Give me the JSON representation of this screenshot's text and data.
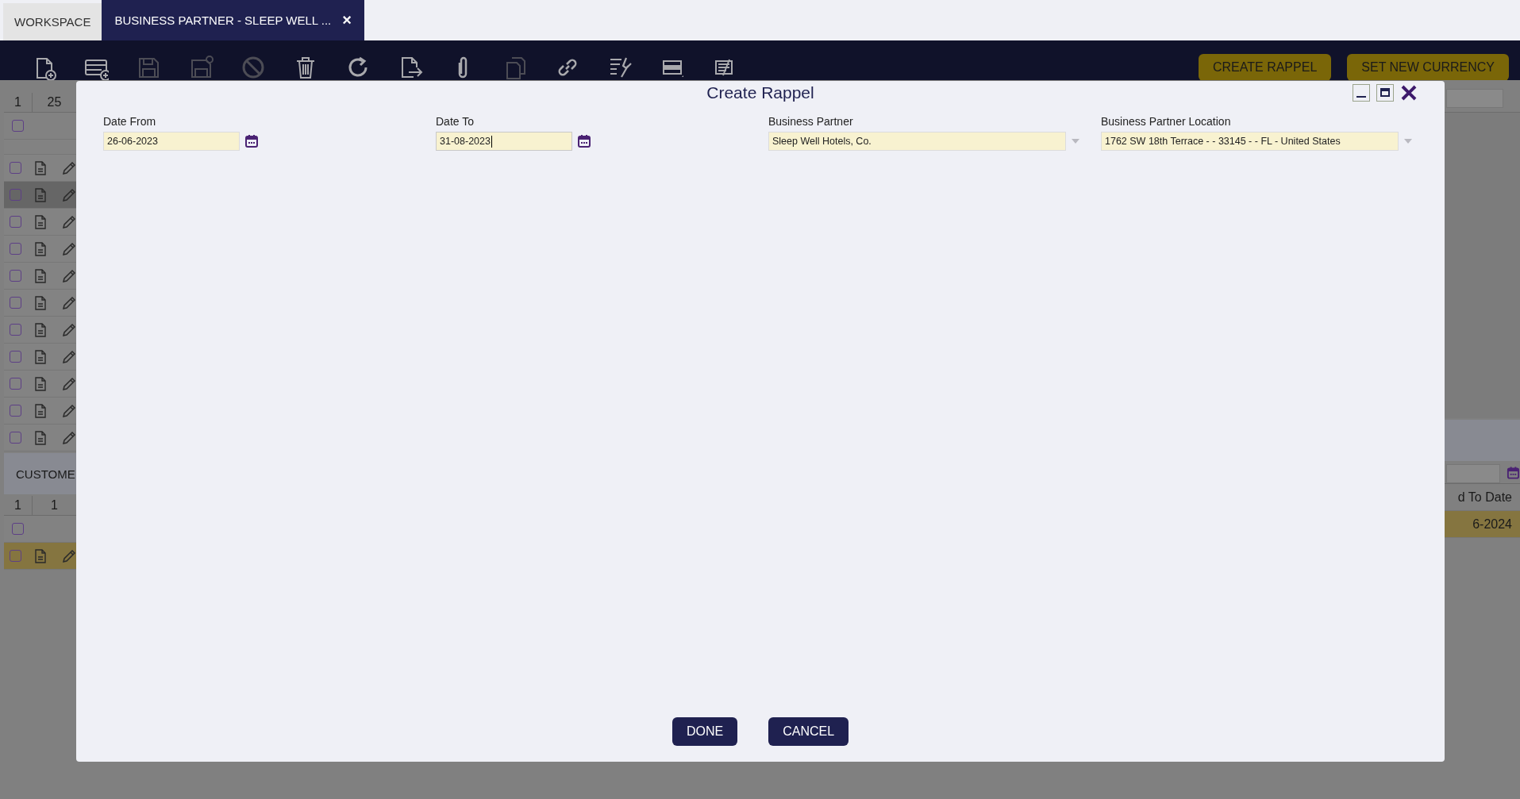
{
  "tabs": [
    {
      "label": "WORKSPACE",
      "selected": false,
      "closable": false
    },
    {
      "label": "BUSINESS PARTNER - SLEEP WELL ...",
      "selected": true,
      "closable": true,
      "close_glyph": "×"
    }
  ],
  "toolbar": [
    {
      "kind": "new-document",
      "disabled": false
    },
    {
      "kind": "new-row",
      "disabled": false
    },
    {
      "kind": "save",
      "disabled": true
    },
    {
      "kind": "save-close",
      "disabled": true
    },
    {
      "kind": "cancel",
      "disabled": true
    },
    {
      "kind": "delete",
      "disabled": false
    },
    {
      "kind": "refresh",
      "disabled": false
    },
    {
      "kind": "export",
      "disabled": false
    },
    {
      "kind": "attach",
      "disabled": false
    },
    {
      "kind": "clone",
      "disabled": true
    },
    {
      "kind": "link",
      "disabled": false
    },
    {
      "kind": "tools",
      "disabled": false
    },
    {
      "kind": "grid-view",
      "disabled": false
    },
    {
      "kind": "notes",
      "disabled": false
    }
  ],
  "actions": [
    "CREATE RAPPEL",
    "SET NEW CURRENCY"
  ],
  "grid": {
    "page": "1",
    "count": "25",
    "header_checked": false,
    "rows": [
      {
        "selected": false,
        "checked": false
      },
      {
        "selected": true,
        "checked": false
      },
      {
        "selected": false,
        "checked": false
      },
      {
        "selected": false,
        "checked": false
      },
      {
        "selected": false,
        "checked": false
      },
      {
        "selected": false,
        "checked": false
      },
      {
        "selected": false,
        "checked": false
      },
      {
        "selected": false,
        "checked": false
      },
      {
        "selected": false,
        "checked": false
      },
      {
        "selected": false,
        "checked": false
      },
      {
        "selected": false,
        "checked": false
      }
    ]
  },
  "customer_section": {
    "title": "CUSTOME",
    "page": "1",
    "count": "1",
    "header_checked": false,
    "column_header": "d To Date",
    "rows": [
      {
        "selected": true,
        "checked": false,
        "cell": "6-2024"
      }
    ]
  },
  "dialog": {
    "title": "Create Rappel",
    "fields": [
      {
        "kind": "date",
        "label": "Date From",
        "value": "26-06-2023",
        "focused": false
      },
      {
        "kind": "date",
        "label": "Date To",
        "value": "31-08-2023",
        "focused": true
      },
      {
        "kind": "combo",
        "label": "Business Partner",
        "value": "Sleep Well Hotels, Co.",
        "focused": false
      },
      {
        "kind": "combo",
        "label": "Business Partner Location",
        "value": "1762 SW 18th Terrace -  - 33145 -  - FL - United States",
        "focused": false
      }
    ],
    "buttons": [
      "DONE",
      "CANCEL"
    ]
  }
}
